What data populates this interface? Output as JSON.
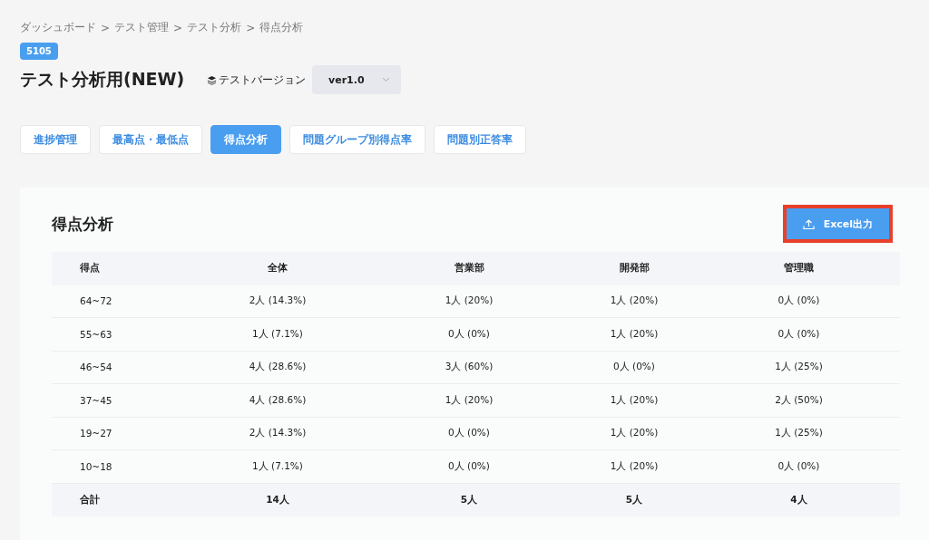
{
  "breadcrumb": [
    "ダッシュボード",
    "テスト管理",
    "テスト分析",
    "得点分析"
  ],
  "breadcrumb_separator": ">",
  "badge": "5105",
  "title": "テスト分析用(NEW)",
  "version": {
    "label": "テストバージョン",
    "value": "ver1.0"
  },
  "tabs": [
    {
      "label": "進捗管理",
      "selected": false
    },
    {
      "label": "最高点・最低点",
      "selected": false
    },
    {
      "label": "得点分析",
      "selected": true
    },
    {
      "label": "問題グループ別得点率",
      "selected": false
    },
    {
      "label": "問題別正答率",
      "selected": false
    }
  ],
  "section": {
    "title": "得点分析",
    "export_button": {
      "label": "Excel出力",
      "highlighted": true
    }
  },
  "table": {
    "columns": [
      "得点",
      "全体",
      "営業部",
      "開発部",
      "管理職"
    ],
    "rows": [
      [
        "64~72",
        "2人 (14.3%)",
        "1人 (20%)",
        "1人 (20%)",
        "0人 (0%)"
      ],
      [
        "55~63",
        "1人 (7.1%)",
        "0人 (0%)",
        "1人 (20%)",
        "0人 (0%)"
      ],
      [
        "46~54",
        "4人 (28.6%)",
        "3人 (60%)",
        "0人 (0%)",
        "1人 (25%)"
      ],
      [
        "37~45",
        "4人 (28.6%)",
        "1人 (20%)",
        "1人 (20%)",
        "2人 (50%)"
      ],
      [
        "19~27",
        "2人 (14.3%)",
        "0人 (0%)",
        "1人 (20%)",
        "1人 (25%)"
      ],
      [
        "10~18",
        "1人 (7.1%)",
        "0人 (0%)",
        "1人 (20%)",
        "0人 (0%)"
      ]
    ],
    "total": [
      "合計",
      "14人",
      "5人",
      "5人",
      "4人"
    ]
  }
}
